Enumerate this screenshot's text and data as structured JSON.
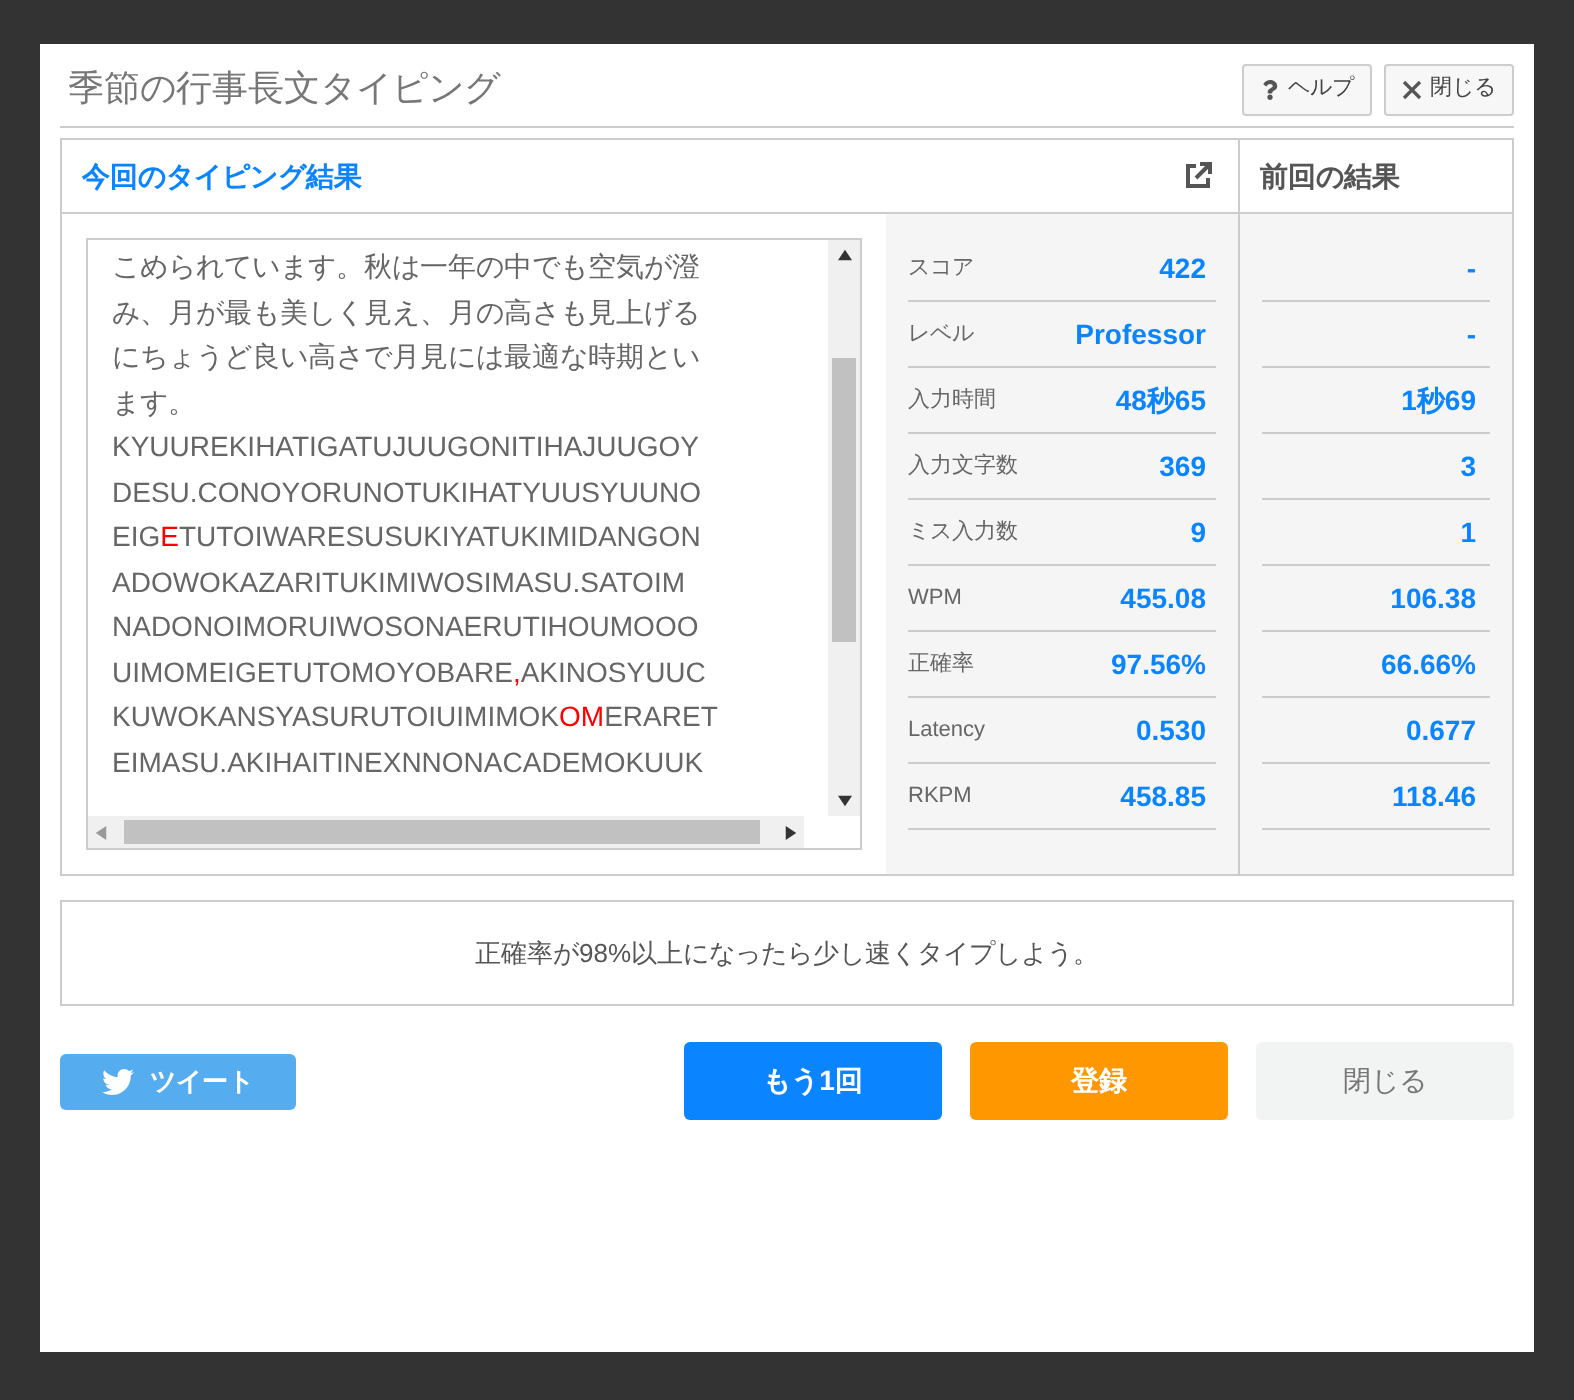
{
  "window": {
    "title": "季節の行事長文タイピング",
    "buttons": [
      {
        "kind": "help",
        "label": "ヘルプ"
      },
      {
        "kind": "close",
        "label": "閉じる"
      }
    ]
  },
  "current": {
    "title": "今回のタイピング結果",
    "text_lines": [
      [
        {
          "text": "こめられています。秋は一年の中でも空気が澄",
          "miss": false
        }
      ],
      [
        {
          "text": "み、月が最も美しく見え、月の高さも見上げる",
          "miss": false
        }
      ],
      [
        {
          "text": "にちょうど良い高さで月見には最適な時期とい",
          "miss": false
        }
      ],
      [
        {
          "text": "ます。",
          "miss": false
        }
      ],
      [
        {
          "text": "KYUUREKIHATIGATUJUUGONITIHAJUUGOY",
          "miss": false
        }
      ],
      [
        {
          "text": "DESU.CONOYORUNOTUKIHATYUUSYUUNO",
          "miss": false
        }
      ],
      [
        {
          "text": "EIG",
          "miss": false
        },
        {
          "text": "E",
          "miss": true
        },
        {
          "text": "TUTOIWARESUSUKIYATUKIMIDANGON",
          "miss": false
        }
      ],
      [
        {
          "text": "ADOWOKAZARITUKIMIWOSIMASU.SATOIM",
          "miss": false
        }
      ],
      [
        {
          "text": "NADONOIMORUIWOSONAERUTIHOUMOOO",
          "miss": false
        }
      ],
      [
        {
          "text": "UIMOMEIGETUTOMOYOBARE",
          "miss": false
        },
        {
          "text": ",",
          "miss": true
        },
        {
          "text": "AKINOSYUUC",
          "miss": false
        }
      ],
      [
        {
          "text": "KUWOKANSYASURUTOIUIMIMOK",
          "miss": false
        },
        {
          "text": "OM",
          "miss": true
        },
        {
          "text": "ERARET",
          "miss": false
        }
      ],
      [
        {
          "text": "EIMASU.AKIHAITINEXNNONACADEMOKUUK",
          "miss": false
        }
      ]
    ],
    "stats": [
      {
        "label": "スコア",
        "value": "422"
      },
      {
        "label": "レベル",
        "value": "Professor"
      },
      {
        "label": "入力時間",
        "value": "48秒65"
      },
      {
        "label": "入力文字数",
        "value": "369"
      },
      {
        "label": "ミス入力数",
        "value": "9"
      },
      {
        "label": "WPM",
        "value": "455.08"
      },
      {
        "label": "正確率",
        "value": "97.56%"
      },
      {
        "label": "Latency",
        "value": "0.530"
      },
      {
        "label": "RKPM",
        "value": "458.85"
      }
    ]
  },
  "previous": {
    "title": "前回の結果",
    "values": [
      "-",
      "-",
      "1秒69",
      "3",
      "1",
      "106.38",
      "66.66%",
      "0.677",
      "118.46"
    ]
  },
  "advice": "正確率が98%以上になったら少し速くタイプしよう。",
  "actions": [
    {
      "kind": "tweet",
      "label": "ツイート"
    },
    {
      "kind": "retry",
      "label": "もう1回"
    },
    {
      "kind": "register",
      "label": "登録"
    },
    {
      "kind": "close",
      "label": "閉じる"
    }
  ]
}
